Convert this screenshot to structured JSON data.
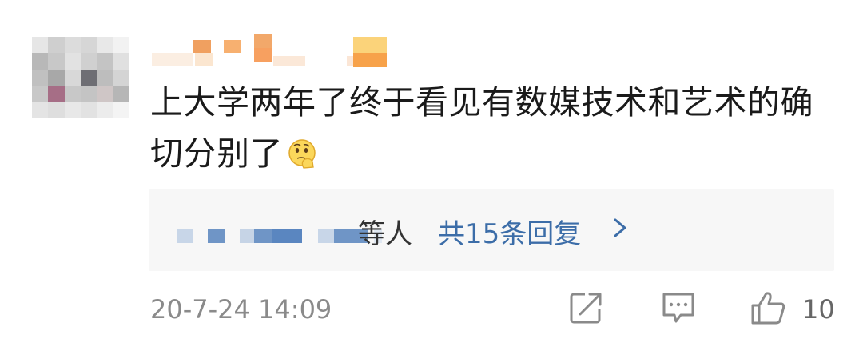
{
  "comment": {
    "text": "上大学两年了终于看见有数媒技术和艺术的确切分别了",
    "emoji_icon": "thinking-face-icon"
  },
  "replies": {
    "suffix": "等人",
    "count_label": "共15条回复"
  },
  "meta": {
    "timestamp": "20-7-24 14:09",
    "like_count": "10"
  },
  "colors": {
    "link": "#3c6da8",
    "muted": "#8a8a8a",
    "reply_bg": "#f7f7f7"
  }
}
